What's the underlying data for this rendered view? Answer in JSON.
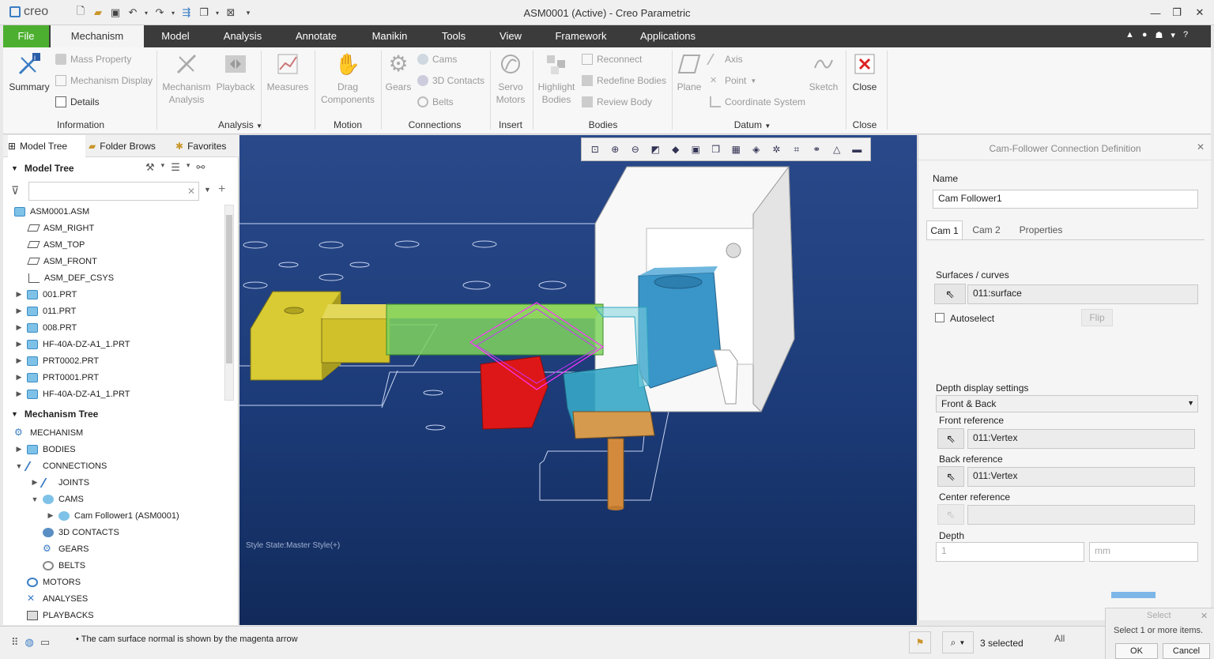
{
  "app": {
    "brand": "creo",
    "window_title": "ASM0001 (Active) - Creo Parametric"
  },
  "menu_tabs": [
    "File",
    "Mechanism",
    "Model",
    "Analysis",
    "Annotate",
    "Manikin",
    "Tools",
    "View",
    "Framework",
    "Applications"
  ],
  "ribbon": {
    "information": {
      "summary": "Summary",
      "mass_property": "Mass Property",
      "mechanism_display": "Mechanism Display",
      "details": "Details",
      "label": "Information"
    },
    "analysis": {
      "mechanism_analysis_1": "Mechanism",
      "mechanism_analysis_2": "Analysis",
      "playback": "Playback",
      "measures": "Measures",
      "label": "Analysis"
    },
    "motion": {
      "drag_1": "Drag",
      "drag_2": "Components",
      "label": "Motion"
    },
    "connections": {
      "gears": "Gears",
      "cams": "Cams",
      "contacts": "3D Contacts",
      "belts": "Belts",
      "label": "Connections"
    },
    "insert": {
      "servo_1": "Servo",
      "servo_2": "Motors",
      "label": "Insert"
    },
    "bodies": {
      "highlight_1": "Highlight",
      "highlight_2": "Bodies",
      "reconnect": "Reconnect",
      "redefine": "Redefine Bodies",
      "review": "Review Body",
      "label": "Bodies"
    },
    "datum": {
      "plane": "Plane",
      "axis": "Axis",
      "point": "Point",
      "csys": "Coordinate System",
      "sketch": "Sketch",
      "label": "Datum"
    },
    "close": {
      "close": "Close",
      "label": "Close"
    }
  },
  "left_tabs": [
    "Model Tree",
    "Folder Brows",
    "Favorites"
  ],
  "model_tree": {
    "title": "Model Tree",
    "items": [
      "ASM0001.ASM",
      "ASM_RIGHT",
      "ASM_TOP",
      "ASM_FRONT",
      "ASM_DEF_CSYS",
      "001.PRT",
      "011.PRT",
      "008.PRT",
      "HF-40A-DZ-A1_1.PRT",
      "PRT0002.PRT",
      "PRT0001.PRT",
      "HF-40A-DZ-A1_1.PRT"
    ]
  },
  "mechanism_tree": {
    "title": "Mechanism Tree",
    "items": [
      "MECHANISM",
      "BODIES",
      "CONNECTIONS",
      "JOINTS",
      "CAMS",
      "Cam Follower1 (ASM0001)",
      "3D CONTACTS",
      "GEARS",
      "BELTS",
      "MOTORS",
      "ANALYSES",
      "PLAYBACKS"
    ]
  },
  "viewport": {
    "style_state": "Style State:Master Style(+)"
  },
  "dialog": {
    "title": "Cam-Follower Connection Definition",
    "name_label": "Name",
    "name_value": "Cam Follower1",
    "tabs": [
      "Cam 1",
      "Cam 2",
      "Properties"
    ],
    "surfaces_label": "Surfaces / curves",
    "surfaces_value": "011:surface",
    "autoselect": "Autoselect",
    "flip": "Flip",
    "depth_display_label": "Depth display settings",
    "depth_display_value": "Front & Back",
    "front_ref_label": "Front reference",
    "front_ref_value": "011:Vertex",
    "back_ref_label": "Back reference",
    "back_ref_value": "011:Vertex",
    "center_ref_label": "Center reference",
    "center_ref_value": "",
    "depth_label": "Depth",
    "depth_value": "1",
    "depth_unit": "mm"
  },
  "status": {
    "message": "The cam surface normal is shown by the magenta arrow",
    "selected": "3 selected",
    "filter": "All",
    "select_label": "Select",
    "select_hint": "Select 1 or more items.",
    "ok": "OK",
    "cancel": "Cancel"
  },
  "colors": {
    "file_tab": "#4caf2f",
    "menu_bar": "#3b3b3b",
    "viewport_top": "#29498a",
    "viewport_bottom": "#112a5a"
  }
}
